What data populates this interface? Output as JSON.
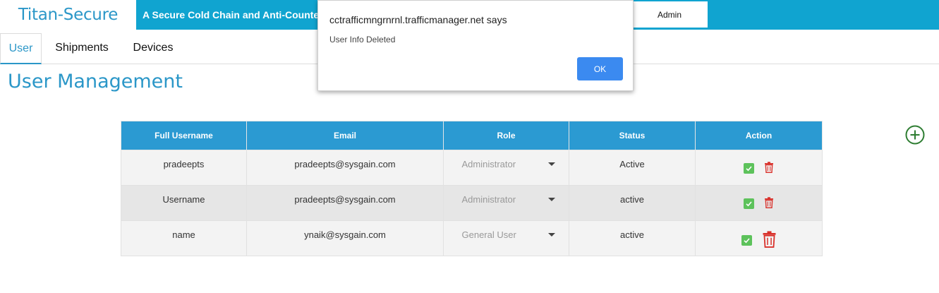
{
  "header": {
    "brand": "Titan-Secure",
    "tagline": "A Secure Cold Chain and Anti-Counterfeit",
    "user_label": "Admin"
  },
  "tabs": [
    {
      "label": "User",
      "active": true
    },
    {
      "label": "Shipments",
      "active": false
    },
    {
      "label": "Devices",
      "active": false
    }
  ],
  "page": {
    "title": "User Management",
    "add_icon": "plus-circle-icon"
  },
  "table": {
    "columns": [
      "Full Username",
      "Email",
      "Role",
      "Status",
      "Action"
    ],
    "rows": [
      {
        "username": "pradeepts",
        "email": "pradeepts@sysgain.com",
        "role": "Administrator",
        "status": "Active"
      },
      {
        "username": "Username",
        "email": "pradeepts@sysgain.com",
        "role": "Administrator",
        "status": "active"
      },
      {
        "username": "name",
        "email": "ynaik@sysgain.com",
        "role": "General User",
        "status": "active"
      }
    ],
    "action_icons": [
      "check-icon",
      "trash-icon"
    ]
  },
  "dialog": {
    "title": "cctrafficmngrnrnl.trafficmanager.net says",
    "message": "User Info Deleted",
    "ok_label": "OK"
  },
  "colors": {
    "brand": "#2b97c8",
    "header_bar": "#10a4d0",
    "table_header": "#2b9ad2",
    "ok_button": "#3b8af0",
    "check": "#5dc25b",
    "trash": "#d9312b",
    "add": "#2e7d32"
  }
}
